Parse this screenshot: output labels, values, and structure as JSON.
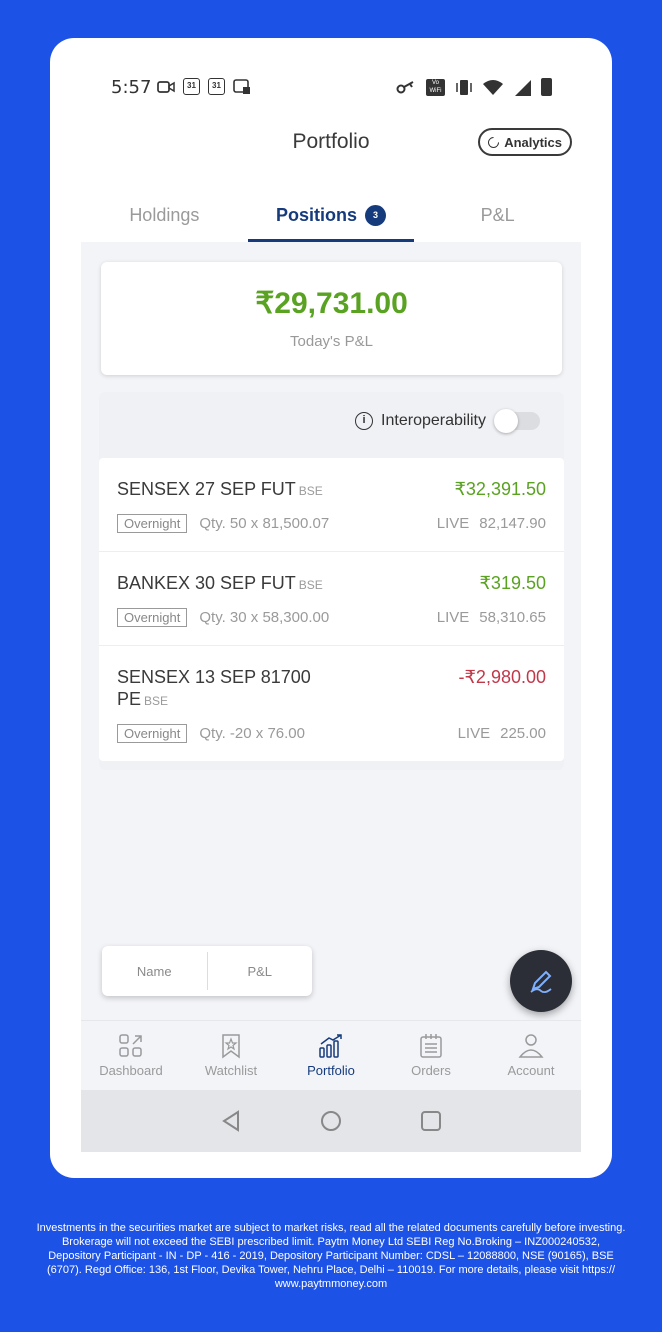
{
  "status_bar": {
    "time": "5:57",
    "left_icons": [
      "video-icon",
      "calendar-icon",
      "calendar-icon",
      "id-card-icon"
    ],
    "right_icons": [
      "key-icon",
      "vowifi-icon",
      "vibrate-icon",
      "wifi-icon",
      "signal-icon",
      "battery-icon"
    ],
    "cal_1": "31",
    "cal_2": "31",
    "vowifi": "Vo WiFi"
  },
  "header": {
    "title": "Portfolio",
    "analytics_label": "Analytics"
  },
  "tabs": [
    {
      "label": "Holdings",
      "active": false
    },
    {
      "label": "Positions",
      "active": true,
      "badge": "3"
    },
    {
      "label": "P&L",
      "active": false
    }
  ],
  "summary": {
    "value": "₹29,731.00",
    "label": "Today's P&L"
  },
  "interoperability": {
    "label": "Interoperability",
    "enabled": false,
    "info_glyph": "i"
  },
  "positions": [
    {
      "instrument": "SENSEX 27 SEP FUT",
      "exchange": "BSE",
      "pnl": "₹32,391.50",
      "pnl_sign": "positive",
      "tag": "Overnight",
      "qty": "Qty. 50 x 81,500.07",
      "ltp_label": "LIVE",
      "ltp": "82,147.90"
    },
    {
      "instrument": "BANKEX 30 SEP FUT",
      "exchange": "BSE",
      "pnl": "₹319.50",
      "pnl_sign": "positive",
      "tag": "Overnight",
      "qty": "Qty. 30 x 58,300.00",
      "ltp_label": "LIVE",
      "ltp": "58,310.65"
    },
    {
      "instrument": "SENSEX 13 SEP 81700 PE",
      "exchange": "BSE",
      "pnl": "-₹2,980.00",
      "pnl_sign": "negative",
      "tag": "Overnight",
      "qty": "Qty. -20 x 76.00",
      "ltp_label": "LIVE",
      "ltp": "225.00"
    }
  ],
  "sort_bar": {
    "name_label": "Name",
    "pnl_label": "P&L"
  },
  "bottom_nav": [
    {
      "label": "Dashboard",
      "icon": "dashboard-icon",
      "active": false
    },
    {
      "label": "Watchlist",
      "icon": "watchlist-icon",
      "active": false
    },
    {
      "label": "Portfolio",
      "icon": "portfolio-icon",
      "active": true
    },
    {
      "label": "Orders",
      "icon": "orders-icon",
      "active": false
    },
    {
      "label": "Account",
      "icon": "account-icon",
      "active": false
    }
  ],
  "colors": {
    "background": "#1d52e6",
    "primary": "#163b7d",
    "positive": "#5aa221",
    "negative": "#c0394a"
  },
  "disclaimer": "Investments in the securities market are subject to market risks, read all the related documents carefully before investing. Brokerage will not exceed the SEBI prescribed limit. Paytm Money Ltd SEBI Reg No.Broking – INZ000240532, Depository Participant - IN - DP - 416 - 2019, Depository Participant Number: CDSL – 12088800, NSE (90165), BSE (6707). Regd Office: 136, 1st Floor, Devika Tower, Nehru Place, Delhi – 110019. For more details, please visit https:// www.paytmmoney.com"
}
